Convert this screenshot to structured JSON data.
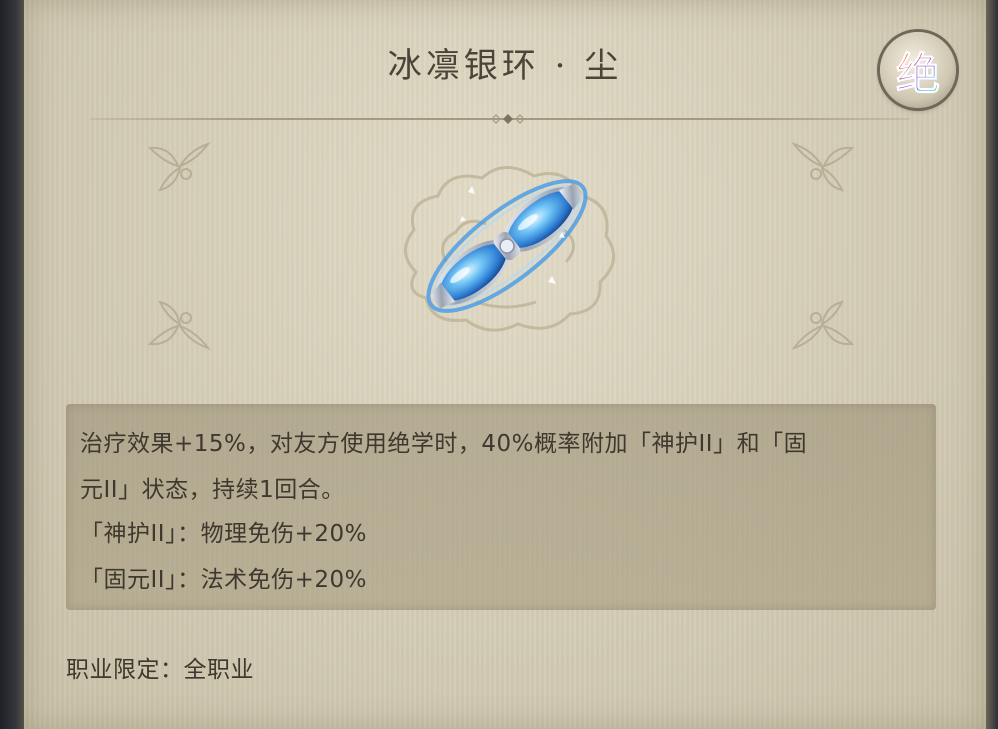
{
  "item": {
    "name": "冰凛银环 · 尘",
    "rarity_badge": "绝"
  },
  "description": {
    "lines": [
      "治疗效果+15%，对友方使用绝学时，40%概率附加「神护II」和「固",
      "元II」状态，持续1回合。",
      "「神护II」：物理免伤+20%",
      "「固元II」：法术免伤+20%"
    ]
  },
  "restriction": "职业限定：全职业",
  "icons": {
    "item_icon": "silver-ring-icon",
    "rarity_icon": "rarity-badge-icon",
    "decor": "corner-ornament-icon"
  },
  "colors": {
    "parchment": "#d6cfb9",
    "text": "#3e382e",
    "title": "#4b4439",
    "gem_blue": "#3b8fe0"
  }
}
